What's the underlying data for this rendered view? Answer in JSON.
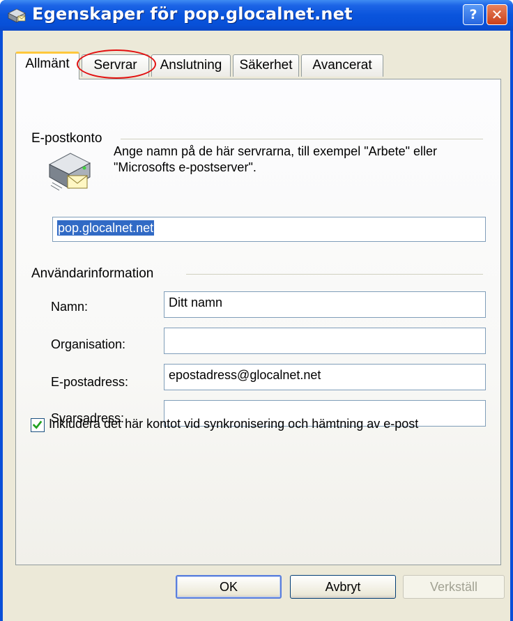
{
  "window": {
    "title": "Egenskaper för pop.glocalnet.net",
    "help_label": "?",
    "close_label": "✕"
  },
  "tabs": [
    {
      "label": "Allmänt",
      "active": true
    },
    {
      "label": "Servrar",
      "active": false,
      "highlighted": true
    },
    {
      "label": "Anslutning",
      "active": false
    },
    {
      "label": "Säkerhet",
      "active": false
    },
    {
      "label": "Avancerat",
      "active": false
    }
  ],
  "mail_account": {
    "group_label": "E-postkonto",
    "description": "Ange namn på de här servrarna, till exempel \"Arbete\" eller \"Microsofts e-postserver\".",
    "account_name": "pop.glocalnet.net"
  },
  "user_info": {
    "group_label": "Användarinformation",
    "fields": [
      {
        "label": "Namn:",
        "value": "Ditt namn"
      },
      {
        "label": "Organisation:",
        "value": ""
      },
      {
        "label": "E-postadress:",
        "value": "epostadress@glocalnet.net"
      },
      {
        "label": "Svarsadress:",
        "value": ""
      }
    ]
  },
  "include_sync": {
    "label": "Inkludera det här kontot vid synkronisering och hämtning av e-post",
    "checked": true
  },
  "buttons": {
    "ok": "OK",
    "cancel": "Avbryt",
    "apply": "Verkställ"
  },
  "colors": {
    "titlebar": "#0a54dc",
    "dialog_bg": "#ece9d8",
    "highlight_ring": "#e21010",
    "selection": "#316ac5"
  }
}
